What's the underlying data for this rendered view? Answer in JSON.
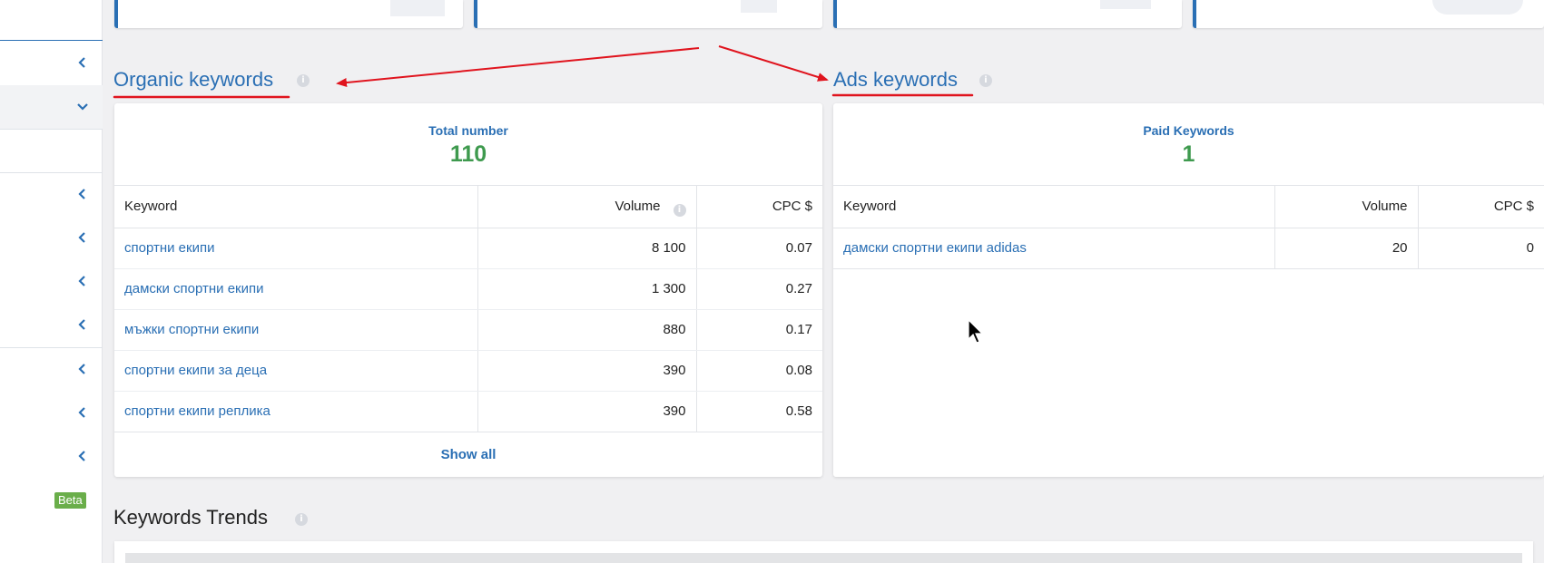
{
  "sidebar": {
    "beta_label": "Beta"
  },
  "organic": {
    "title": "Organic keywords",
    "summary_label": "Total number",
    "summary_value": "110",
    "columns": {
      "keyword": "Keyword",
      "volume": "Volume",
      "cpc": "CPC $"
    },
    "rows": [
      {
        "keyword": "спортни екипи",
        "volume": "8 100",
        "cpc": "0.07"
      },
      {
        "keyword": "дамски спортни екипи",
        "volume": "1 300",
        "cpc": "0.27"
      },
      {
        "keyword": "мъжки спортни екипи",
        "volume": "880",
        "cpc": "0.17"
      },
      {
        "keyword": "спортни екипи за деца",
        "volume": "390",
        "cpc": "0.08"
      },
      {
        "keyword": "спортни екипи реплика",
        "volume": "390",
        "cpc": "0.58"
      }
    ],
    "show_all": "Show all"
  },
  "ads": {
    "title": "Ads keywords",
    "summary_label": "Paid Keywords",
    "summary_value": "1",
    "columns": {
      "keyword": "Keyword",
      "volume": "Volume",
      "cpc": "CPC $"
    },
    "rows": [
      {
        "keyword": "дамски спортни екипи adidas",
        "volume": "20",
        "cpc": "0"
      }
    ]
  },
  "trends": {
    "title": "Keywords Trends"
  },
  "colors": {
    "accent": "#2a6fb4",
    "value_green": "#3e9a4e",
    "annotation_red": "#e0141e",
    "beta_green": "#6aae4a"
  },
  "icons": [
    "chevron-left-icon",
    "chevron-down-icon",
    "info-icon",
    "mouse-cursor-icon"
  ]
}
